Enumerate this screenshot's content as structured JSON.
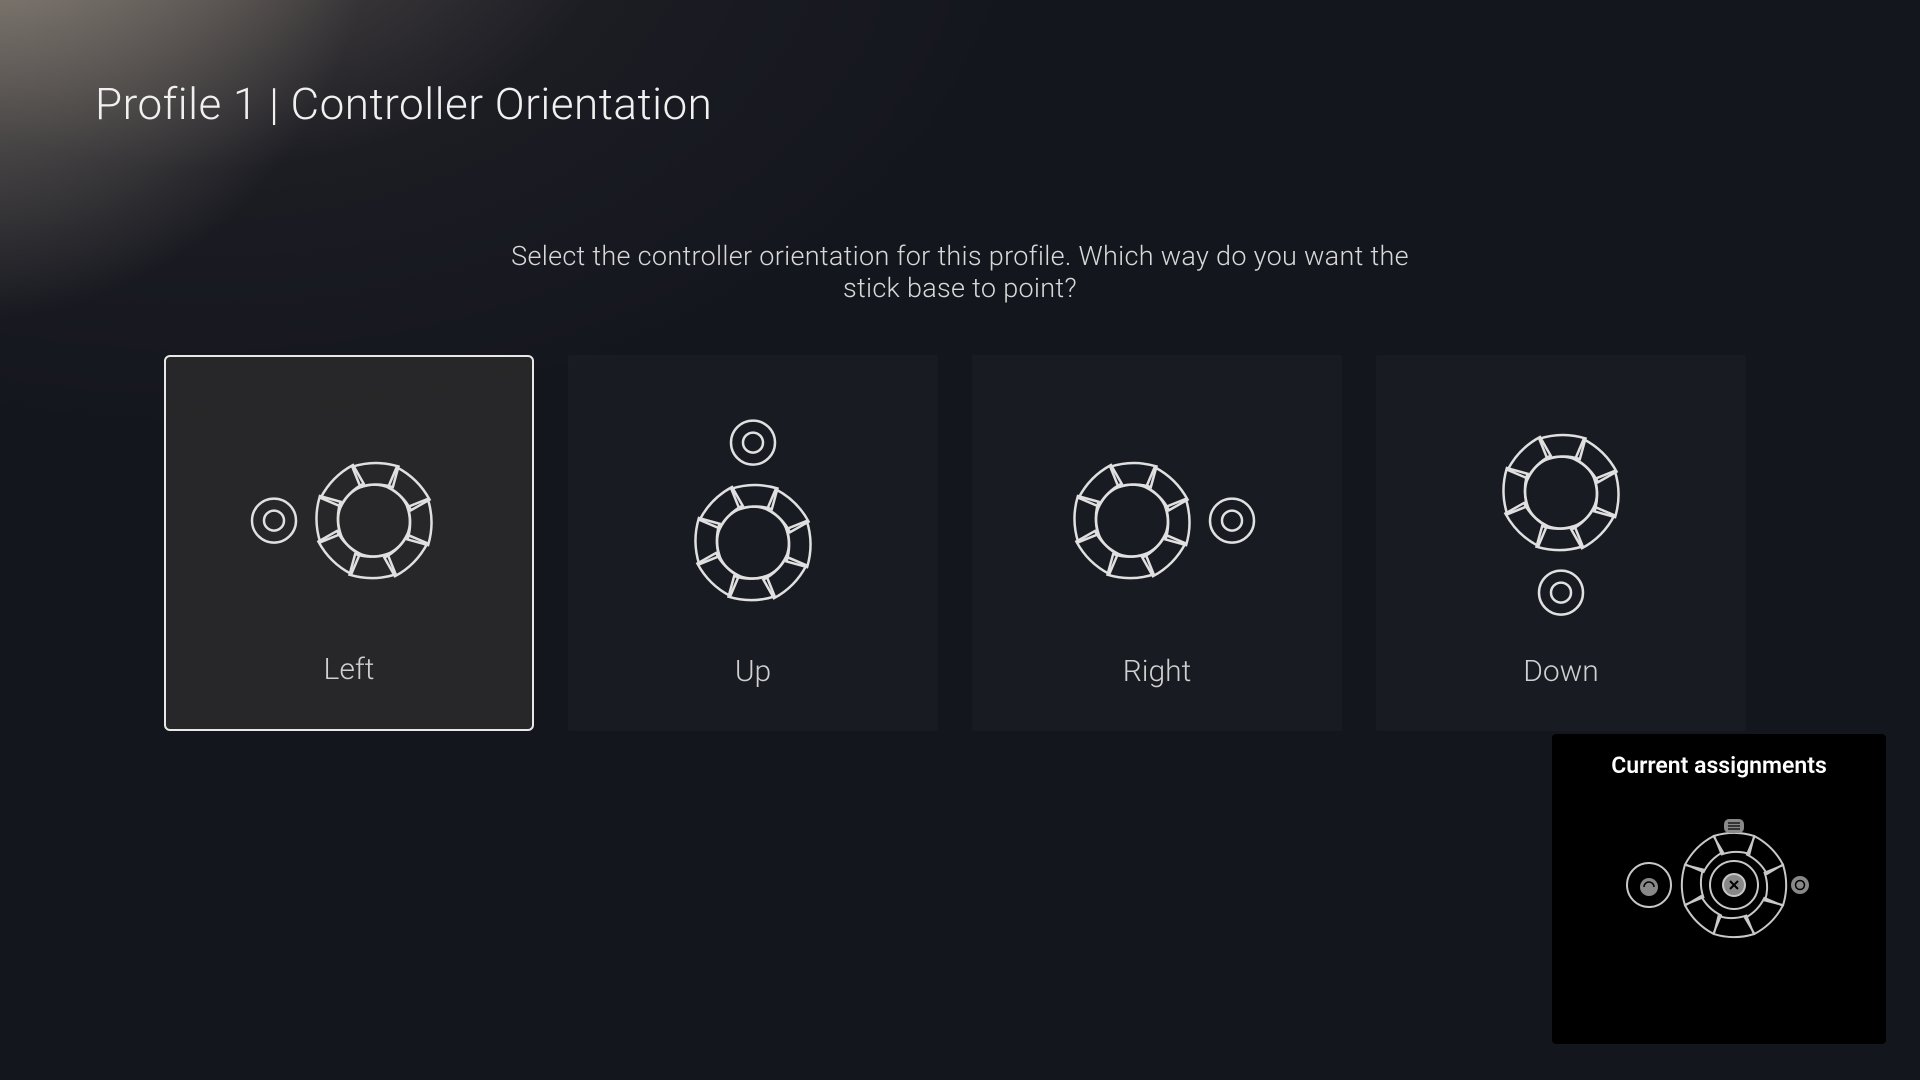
{
  "header": {
    "title": "Profile 1 | Controller Orientation"
  },
  "subtitle": "Select the controller orientation for this profile. Which way do you want the stick base to point?",
  "options": [
    {
      "label": "Left",
      "selected": true
    },
    {
      "label": "Up",
      "selected": false
    },
    {
      "label": "Right",
      "selected": false
    },
    {
      "label": "Down",
      "selected": false
    }
  ],
  "assignments": {
    "title": "Current assignments"
  }
}
